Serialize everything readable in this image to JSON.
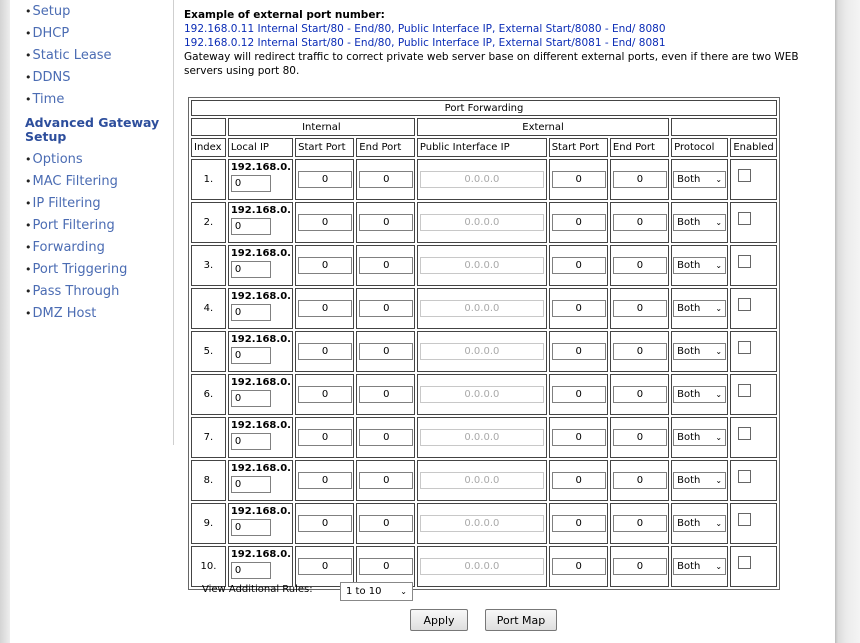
{
  "sidebar": {
    "items_top": [
      "Setup",
      "DHCP",
      "Static Lease",
      "DDNS",
      "Time"
    ],
    "section_heading": "Advanced Gateway Setup",
    "items_bottom": [
      "Options",
      "MAC Filtering",
      "IP Filtering",
      "Port Filtering",
      "Forwarding",
      "Port Triggering",
      "Pass Through",
      "DMZ Host"
    ]
  },
  "intro": {
    "heading": "Example of external port number:",
    "example1": "192.168.0.11 Internal Start/80 - End/80, Public Interface IP, External Start/8080 - End/ 8080",
    "example2": "192.168.0.12 Internal Start/80 - End/80, Public Interface IP, External Start/8081 - End/ 8081",
    "description": "Gateway will redirect traffic to correct private web server base on different external ports, even if there are two WEB servers using port 80."
  },
  "table": {
    "title": "Port Forwarding",
    "group_internal": "Internal",
    "group_external": "External",
    "columns": {
      "index": "Index",
      "local_ip": "Local IP",
      "int_start": "Start Port",
      "int_end": "End Port",
      "public_ip": "Public Interface IP",
      "ext_start": "Start Port",
      "ext_end": "End Port",
      "protocol": "Protocol",
      "enabled": "Enabled"
    },
    "rows": [
      {
        "index": "1.",
        "ip_prefix": "192.168.0.",
        "ip_last": "0",
        "int_start": "0",
        "int_end": "0",
        "public_ip": "0.0.0.0",
        "ext_start": "0",
        "ext_end": "0",
        "protocol": "Both",
        "enabled": false
      },
      {
        "index": "2.",
        "ip_prefix": "192.168.0.",
        "ip_last": "0",
        "int_start": "0",
        "int_end": "0",
        "public_ip": "0.0.0.0",
        "ext_start": "0",
        "ext_end": "0",
        "protocol": "Both",
        "enabled": false
      },
      {
        "index": "3.",
        "ip_prefix": "192.168.0.",
        "ip_last": "0",
        "int_start": "0",
        "int_end": "0",
        "public_ip": "0.0.0.0",
        "ext_start": "0",
        "ext_end": "0",
        "protocol": "Both",
        "enabled": false
      },
      {
        "index": "4.",
        "ip_prefix": "192.168.0.",
        "ip_last": "0",
        "int_start": "0",
        "int_end": "0",
        "public_ip": "0.0.0.0",
        "ext_start": "0",
        "ext_end": "0",
        "protocol": "Both",
        "enabled": false
      },
      {
        "index": "5.",
        "ip_prefix": "192.168.0.",
        "ip_last": "0",
        "int_start": "0",
        "int_end": "0",
        "public_ip": "0.0.0.0",
        "ext_start": "0",
        "ext_end": "0",
        "protocol": "Both",
        "enabled": false
      },
      {
        "index": "6.",
        "ip_prefix": "192.168.0.",
        "ip_last": "0",
        "int_start": "0",
        "int_end": "0",
        "public_ip": "0.0.0.0",
        "ext_start": "0",
        "ext_end": "0",
        "protocol": "Both",
        "enabled": false
      },
      {
        "index": "7.",
        "ip_prefix": "192.168.0.",
        "ip_last": "0",
        "int_start": "0",
        "int_end": "0",
        "public_ip": "0.0.0.0",
        "ext_start": "0",
        "ext_end": "0",
        "protocol": "Both",
        "enabled": false
      },
      {
        "index": "8.",
        "ip_prefix": "192.168.0.",
        "ip_last": "0",
        "int_start": "0",
        "int_end": "0",
        "public_ip": "0.0.0.0",
        "ext_start": "0",
        "ext_end": "0",
        "protocol": "Both",
        "enabled": false
      },
      {
        "index": "9.",
        "ip_prefix": "192.168.0.",
        "ip_last": "0",
        "int_start": "0",
        "int_end": "0",
        "public_ip": "0.0.0.0",
        "ext_start": "0",
        "ext_end": "0",
        "protocol": "Both",
        "enabled": false
      },
      {
        "index": "10.",
        "ip_prefix": "192.168.0.",
        "ip_last": "0",
        "int_start": "0",
        "int_end": "0",
        "public_ip": "0.0.0.0",
        "ext_start": "0",
        "ext_end": "0",
        "protocol": "Both",
        "enabled": false
      }
    ]
  },
  "footer": {
    "view_label": "View Additional Rules:",
    "view_value": "1 to 10",
    "apply_label": "Apply",
    "port_map_label": "Port Map"
  },
  "colors": {
    "nav_link": "#4b6cb3",
    "section_heading": "#2d4e9c",
    "example_text": "#0b2cb6"
  }
}
